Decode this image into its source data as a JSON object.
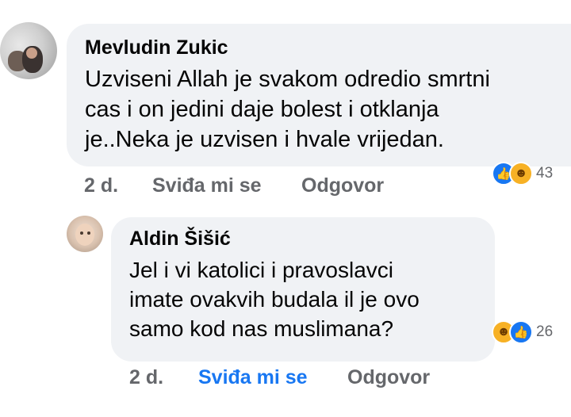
{
  "comments": [
    {
      "author": "Mevludin Zukic",
      "text": "Uzviseni Allah je svakom odredio smrtni\ncas i on jedini daje bolest i otklanja\nje..Neka je uzvisen i hvale vrijedan.",
      "time": "2 d.",
      "like_label": "Sviđa mi se",
      "reply_label": "Odgovor",
      "reaction_count": "43",
      "reactions": [
        "like-icon",
        "haha-icon"
      ]
    },
    {
      "author": "Aldin Šišić",
      "text": "Jel i vi katolici i pravoslavci\nimate ovakvih budala il je ovo\nsamo kod nas muslimana?",
      "time": "2 d.",
      "like_label": "Sviđa mi se",
      "reply_label": "Odgovor",
      "reaction_count": "26",
      "reactions": [
        "haha-icon",
        "like-icon"
      ],
      "liked": true
    }
  ],
  "colors": {
    "bubble": "#f0f2f5",
    "meta": "#65676b",
    "liked": "#1877f2"
  }
}
